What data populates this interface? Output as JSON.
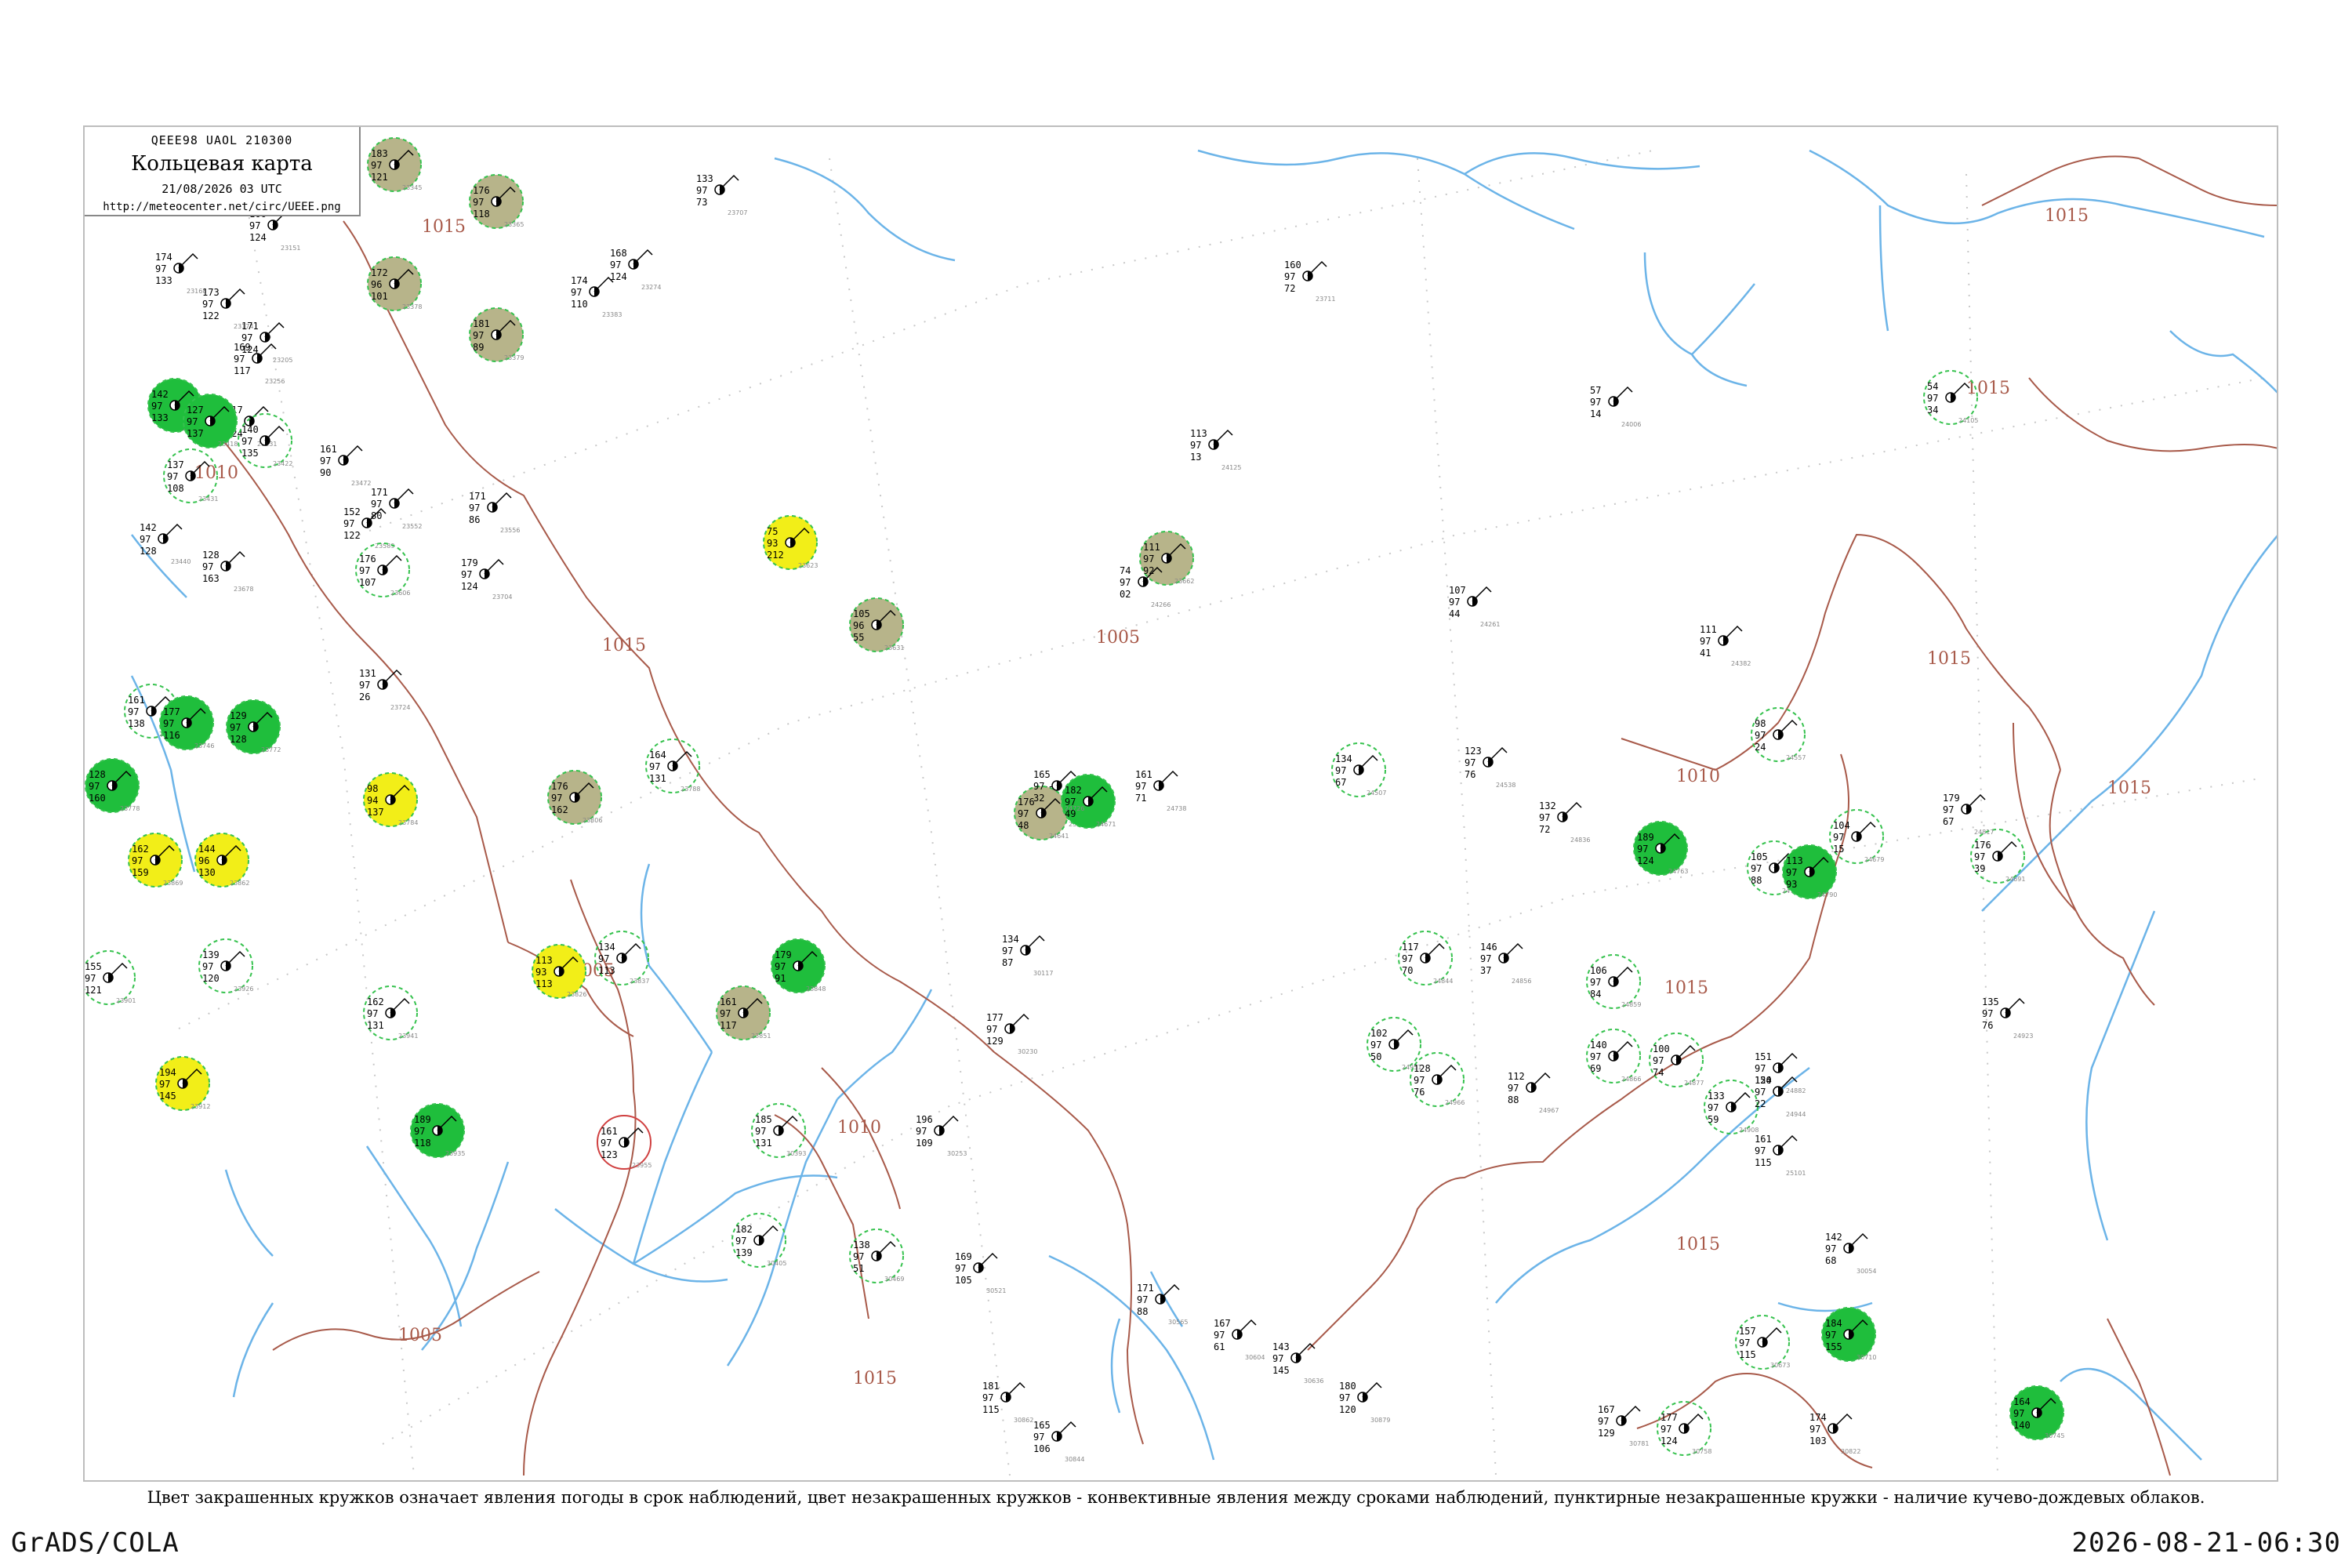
{
  "header": {
    "code": "QEEE98  UAOL  210300",
    "title": "Кольцевая карта",
    "date": "21/08/2026 03 UTC",
    "url": "http://meteocenter.net/circ/UEEE.png"
  },
  "caption": "Цвет закрашенных кружков означает явления погоды в срок наблюдений, цвет незакрашенных кружков - конвективные явления между сроками наблюдений, пунктирные незакрашенные кружки - наличие кучево-дождевых облаков.",
  "footer": {
    "left": "GrADS/COLA",
    "right": "2026-08-21-06:30"
  },
  "colors": {
    "isobar": "#a85a4a",
    "river": "#6cb4e8",
    "thunder_fill": "#1fbe3c",
    "rain_fill": "#f2ee18",
    "fog_fill": "#b7b48a",
    "shower_fill": "#52e07a",
    "cb_dashed": "#36c24e",
    "grid": "#c8c8c8"
  },
  "isobar_labels": [
    {
      "text": "1015"
    },
    {
      "text": "1010"
    },
    {
      "text": "1015"
    },
    {
      "text": "1005"
    },
    {
      "text": "1005"
    },
    {
      "text": "1010"
    },
    {
      "text": "1015"
    },
    {
      "text": "1005"
    },
    {
      "text": "1015"
    },
    {
      "text": "1015"
    },
    {
      "text": "1010"
    },
    {
      "text": "1015"
    },
    {
      "text": "1015"
    },
    {
      "text": "1015"
    },
    {
      "text": "1015"
    }
  ],
  "stations": [
    {
      "id": "23345",
      "vals": [
        "183",
        "97",
        "121"
      ],
      "circle": "fog"
    },
    {
      "id": "23365",
      "vals": [
        "176",
        "97",
        "118"
      ],
      "circle": "fog"
    },
    {
      "id": "23378",
      "vals": [
        "172",
        "96",
        "101"
      ],
      "circle": "fog"
    },
    {
      "id": "23379",
      "vals": [
        "181",
        "97",
        "89"
      ],
      "circle": "fog"
    },
    {
      "id": "23151",
      "vals": [
        "166",
        "97",
        "124"
      ],
      "circle": "none"
    },
    {
      "id": "23168",
      "vals": [
        "174",
        "97",
        "133"
      ],
      "circle": "none"
    },
    {
      "id": "23174",
      "vals": [
        "173",
        "97",
        "122"
      ],
      "circle": "none"
    },
    {
      "id": "23205",
      "vals": [
        "171",
        "97",
        "124"
      ],
      "circle": "none"
    },
    {
      "id": "23231",
      "vals": [
        "117",
        "97",
        "124"
      ],
      "circle": "none"
    },
    {
      "id": "23256",
      "vals": [
        "169",
        "97",
        "117"
      ],
      "circle": "none"
    },
    {
      "id": "23274",
      "vals": [
        "168",
        "97",
        "124"
      ],
      "circle": "none"
    },
    {
      "id": "23383",
      "vals": [
        "174",
        "97",
        "110"
      ],
      "circle": "none"
    },
    {
      "id": "23405",
      "vals": [
        "142",
        "97",
        "133"
      ],
      "circle": "thunder"
    },
    {
      "id": "23418",
      "vals": [
        "127",
        "97",
        "137"
      ],
      "circle": "thunder"
    },
    {
      "id": "23422",
      "vals": [
        "140",
        "97",
        "135"
      ],
      "circle": "cb"
    },
    {
      "id": "23431",
      "vals": [
        "137",
        "97",
        "108"
      ],
      "circle": "cb"
    },
    {
      "id": "23440",
      "vals": [
        "142",
        "97",
        "128"
      ],
      "circle": "none"
    },
    {
      "id": "23472",
      "vals": [
        "161",
        "97",
        "90"
      ],
      "circle": "none"
    },
    {
      "id": "23552",
      "vals": [
        "171",
        "97",
        "80"
      ],
      "circle": "none"
    },
    {
      "id": "23556",
      "vals": [
        "171",
        "97",
        "86"
      ],
      "circle": "none"
    },
    {
      "id": "23589",
      "vals": [
        "152",
        "97",
        "122"
      ],
      "circle": "none"
    },
    {
      "id": "23606",
      "vals": [
        "176",
        "97",
        "107"
      ],
      "circle": "cb"
    },
    {
      "id": "23623",
      "vals": [
        "75",
        "93",
        "212"
      ],
      "circle": "rain"
    },
    {
      "id": "23631",
      "vals": [
        "105",
        "96",
        "55"
      ],
      "circle": "fog"
    },
    {
      "id": "23662",
      "vals": [
        "111",
        "97",
        "92"
      ],
      "circle": "fog"
    },
    {
      "id": "23678",
      "vals": [
        "128",
        "97",
        "163"
      ],
      "circle": "none"
    },
    {
      "id": "23704",
      "vals": [
        "179",
        "97",
        "124"
      ],
      "circle": "none"
    },
    {
      "id": "23707",
      "vals": [
        "133",
        "97",
        "73"
      ],
      "circle": "none"
    },
    {
      "id": "23711",
      "vals": [
        "160",
        "97",
        "72"
      ],
      "circle": "none"
    },
    {
      "id": "23724",
      "vals": [
        "131",
        "97",
        "26"
      ],
      "circle": "none"
    },
    {
      "id": "23734",
      "vals": [
        "161",
        "97",
        "138"
      ],
      "circle": "cb"
    },
    {
      "id": "23746",
      "vals": [
        "177",
        "97",
        "116"
      ],
      "circle": "thunder"
    },
    {
      "id": "23772",
      "vals": [
        "129",
        "97",
        "128"
      ],
      "circle": "thunder"
    },
    {
      "id": "23778",
      "vals": [
        "128",
        "97",
        "160"
      ],
      "circle": "thunder"
    },
    {
      "id": "23784",
      "vals": [
        "98",
        "94",
        "137"
      ],
      "circle": "rain"
    },
    {
      "id": "23788",
      "vals": [
        "164",
        "97",
        "131"
      ],
      "circle": "cb"
    },
    {
      "id": "23804",
      "vals": [
        "155",
        "97",
        "54"
      ],
      "circle": "none"
    },
    {
      "id": "23806",
      "vals": [
        "176",
        "97",
        "162"
      ],
      "circle": "fog"
    },
    {
      "id": "23826",
      "vals": [
        "113",
        "93",
        "113"
      ],
      "circle": "rain"
    },
    {
      "id": "23837",
      "vals": [
        "134",
        "97",
        "113"
      ],
      "circle": "cb"
    },
    {
      "id": "23848",
      "vals": [
        "179",
        "97",
        "91"
      ],
      "circle": "thunder"
    },
    {
      "id": "23851",
      "vals": [
        "161",
        "97",
        "117"
      ],
      "circle": "fog"
    },
    {
      "id": "23862",
      "vals": [
        "144",
        "96",
        "130"
      ],
      "circle": "rain"
    },
    {
      "id": "23869",
      "vals": [
        "162",
        "97",
        "159"
      ],
      "circle": "rain"
    },
    {
      "id": "23901",
      "vals": [
        "155",
        "97",
        "121"
      ],
      "circle": "cb"
    },
    {
      "id": "23912",
      "vals": [
        "194",
        "97",
        "145"
      ],
      "circle": "rain"
    },
    {
      "id": "23926",
      "vals": [
        "139",
        "97",
        "120"
      ],
      "circle": "cb"
    },
    {
      "id": "23935",
      "vals": [
        "189",
        "97",
        "118"
      ],
      "circle": "thunder"
    },
    {
      "id": "23941",
      "vals": [
        "162",
        "97",
        "131"
      ],
      "circle": "cb"
    },
    {
      "id": "23955",
      "vals": [
        "161",
        "97",
        "123"
      ],
      "circle": "thunderstorm-red"
    },
    {
      "id": "24006",
      "vals": [
        "57",
        "97",
        "14"
      ],
      "circle": "none"
    },
    {
      "id": "24105",
      "vals": [
        "54",
        "97",
        "34"
      ],
      "circle": "cb"
    },
    {
      "id": "24125",
      "vals": [
        "113",
        "97",
        "13"
      ],
      "circle": "none"
    },
    {
      "id": "24261",
      "vals": [
        "107",
        "97",
        "44"
      ],
      "circle": "none"
    },
    {
      "id": "24266",
      "vals": [
        "74",
        "97",
        "02"
      ],
      "circle": "none"
    },
    {
      "id": "24382",
      "vals": [
        "111",
        "97",
        "41"
      ],
      "circle": "none"
    },
    {
      "id": "24507",
      "vals": [
        "134",
        "97",
        "67"
      ],
      "circle": "cb"
    },
    {
      "id": "24538",
      "vals": [
        "123",
        "97",
        "76"
      ],
      "circle": "none"
    },
    {
      "id": "24557",
      "vals": [
        "98",
        "97",
        "24"
      ],
      "circle": "cb"
    },
    {
      "id": "24641",
      "vals": [
        "176",
        "97",
        "48"
      ],
      "circle": "fog"
    },
    {
      "id": "24671",
      "vals": [
        "182",
        "97",
        "49"
      ],
      "circle": "thunder"
    },
    {
      "id": "24679",
      "vals": [
        "104",
        "97",
        "15"
      ],
      "circle": "cb"
    },
    {
      "id": "24691",
      "vals": [
        "176",
        "97",
        "39"
      ],
      "circle": "cb"
    },
    {
      "id": "24726",
      "vals": [
        "165",
        "97",
        "32"
      ],
      "circle": "none"
    },
    {
      "id": "24738",
      "vals": [
        "161",
        "97",
        "71"
      ],
      "circle": "none"
    },
    {
      "id": "24763",
      "vals": [
        "189",
        "97",
        "124"
      ],
      "circle": "thunder"
    },
    {
      "id": "24768",
      "vals": [
        "105",
        "97",
        "88"
      ],
      "circle": "cb"
    },
    {
      "id": "24790",
      "vals": [
        "113",
        "97",
        "93"
      ],
      "circle": "thunder"
    },
    {
      "id": "24817",
      "vals": [
        "179",
        "97",
        "67"
      ],
      "circle": "none"
    },
    {
      "id": "24836",
      "vals": [
        "132",
        "97",
        "72"
      ],
      "circle": "none"
    },
    {
      "id": "24844",
      "vals": [
        "117",
        "97",
        "70"
      ],
      "circle": "cb"
    },
    {
      "id": "24856",
      "vals": [
        "146",
        "97",
        "37"
      ],
      "circle": "none"
    },
    {
      "id": "24859",
      "vals": [
        "106",
        "97",
        "84"
      ],
      "circle": "cb"
    },
    {
      "id": "24866",
      "vals": [
        "140",
        "97",
        "69"
      ],
      "circle": "cb"
    },
    {
      "id": "24877",
      "vals": [
        "100",
        "97",
        "74"
      ],
      "circle": "cb"
    },
    {
      "id": "24882",
      "vals": [
        "151",
        "97",
        "124"
      ],
      "circle": "none"
    },
    {
      "id": "24908",
      "vals": [
        "133",
        "97",
        "59"
      ],
      "circle": "cb"
    },
    {
      "id": "24923",
      "vals": [
        "135",
        "97",
        "76"
      ],
      "circle": "none"
    },
    {
      "id": "24944",
      "vals": [
        "150",
        "97",
        "22"
      ],
      "circle": "none"
    },
    {
      "id": "24951",
      "vals": [
        "102",
        "97",
        "50"
      ],
      "circle": "cb"
    },
    {
      "id": "24966",
      "vals": [
        "128",
        "97",
        "76"
      ],
      "circle": "cb"
    },
    {
      "id": "24967",
      "vals": [
        "112",
        "97",
        "88"
      ],
      "circle": "none"
    },
    {
      "id": "25101",
      "vals": [
        "161",
        "97",
        "115"
      ],
      "circle": "none"
    },
    {
      "id": "30054",
      "vals": [
        "142",
        "97",
        "68"
      ],
      "circle": "none"
    },
    {
      "id": "30117",
      "vals": [
        "134",
        "97",
        "87"
      ],
      "circle": "none"
    },
    {
      "id": "30230",
      "vals": [
        "177",
        "97",
        "129"
      ],
      "circle": "none"
    },
    {
      "id": "30253",
      "vals": [
        "196",
        "97",
        "109"
      ],
      "circle": "none"
    },
    {
      "id": "30393",
      "vals": [
        "185",
        "97",
        "131"
      ],
      "circle": "cb"
    },
    {
      "id": "30405",
      "vals": [
        "182",
        "97",
        "139"
      ],
      "circle": "cb"
    },
    {
      "id": "30469",
      "vals": [
        "138",
        "97",
        "51"
      ],
      "circle": "cb"
    },
    {
      "id": "30521",
      "vals": [
        "169",
        "97",
        "105"
      ],
      "circle": "none"
    },
    {
      "id": "30565",
      "vals": [
        "171",
        "97",
        "88"
      ],
      "circle": "none"
    },
    {
      "id": "30604",
      "vals": [
        "167",
        "97",
        "61"
      ],
      "circle": "none"
    },
    {
      "id": "30636",
      "vals": [
        "143",
        "97",
        "145"
      ],
      "circle": "none"
    },
    {
      "id": "30673",
      "vals": [
        "157",
        "97",
        "115"
      ],
      "circle": "cb"
    },
    {
      "id": "30710",
      "vals": [
        "184",
        "97",
        "155"
      ],
      "circle": "thunder"
    },
    {
      "id": "30745",
      "vals": [
        "164",
        "97",
        "140"
      ],
      "circle": "thunder"
    },
    {
      "id": "30758",
      "vals": [
        "177",
        "97",
        "124"
      ],
      "circle": "cb"
    },
    {
      "id": "30781",
      "vals": [
        "167",
        "97",
        "129"
      ],
      "circle": "none"
    },
    {
      "id": "30822",
      "vals": [
        "174",
        "97",
        "103"
      ],
      "circle": "none"
    },
    {
      "id": "30844",
      "vals": [
        "165",
        "97",
        "106"
      ],
      "circle": "none"
    },
    {
      "id": "30862",
      "vals": [
        "181",
        "97",
        "115"
      ],
      "circle": "none"
    },
    {
      "id": "30879",
      "vals": [
        "180",
        "97",
        "120"
      ],
      "circle": "none"
    }
  ]
}
